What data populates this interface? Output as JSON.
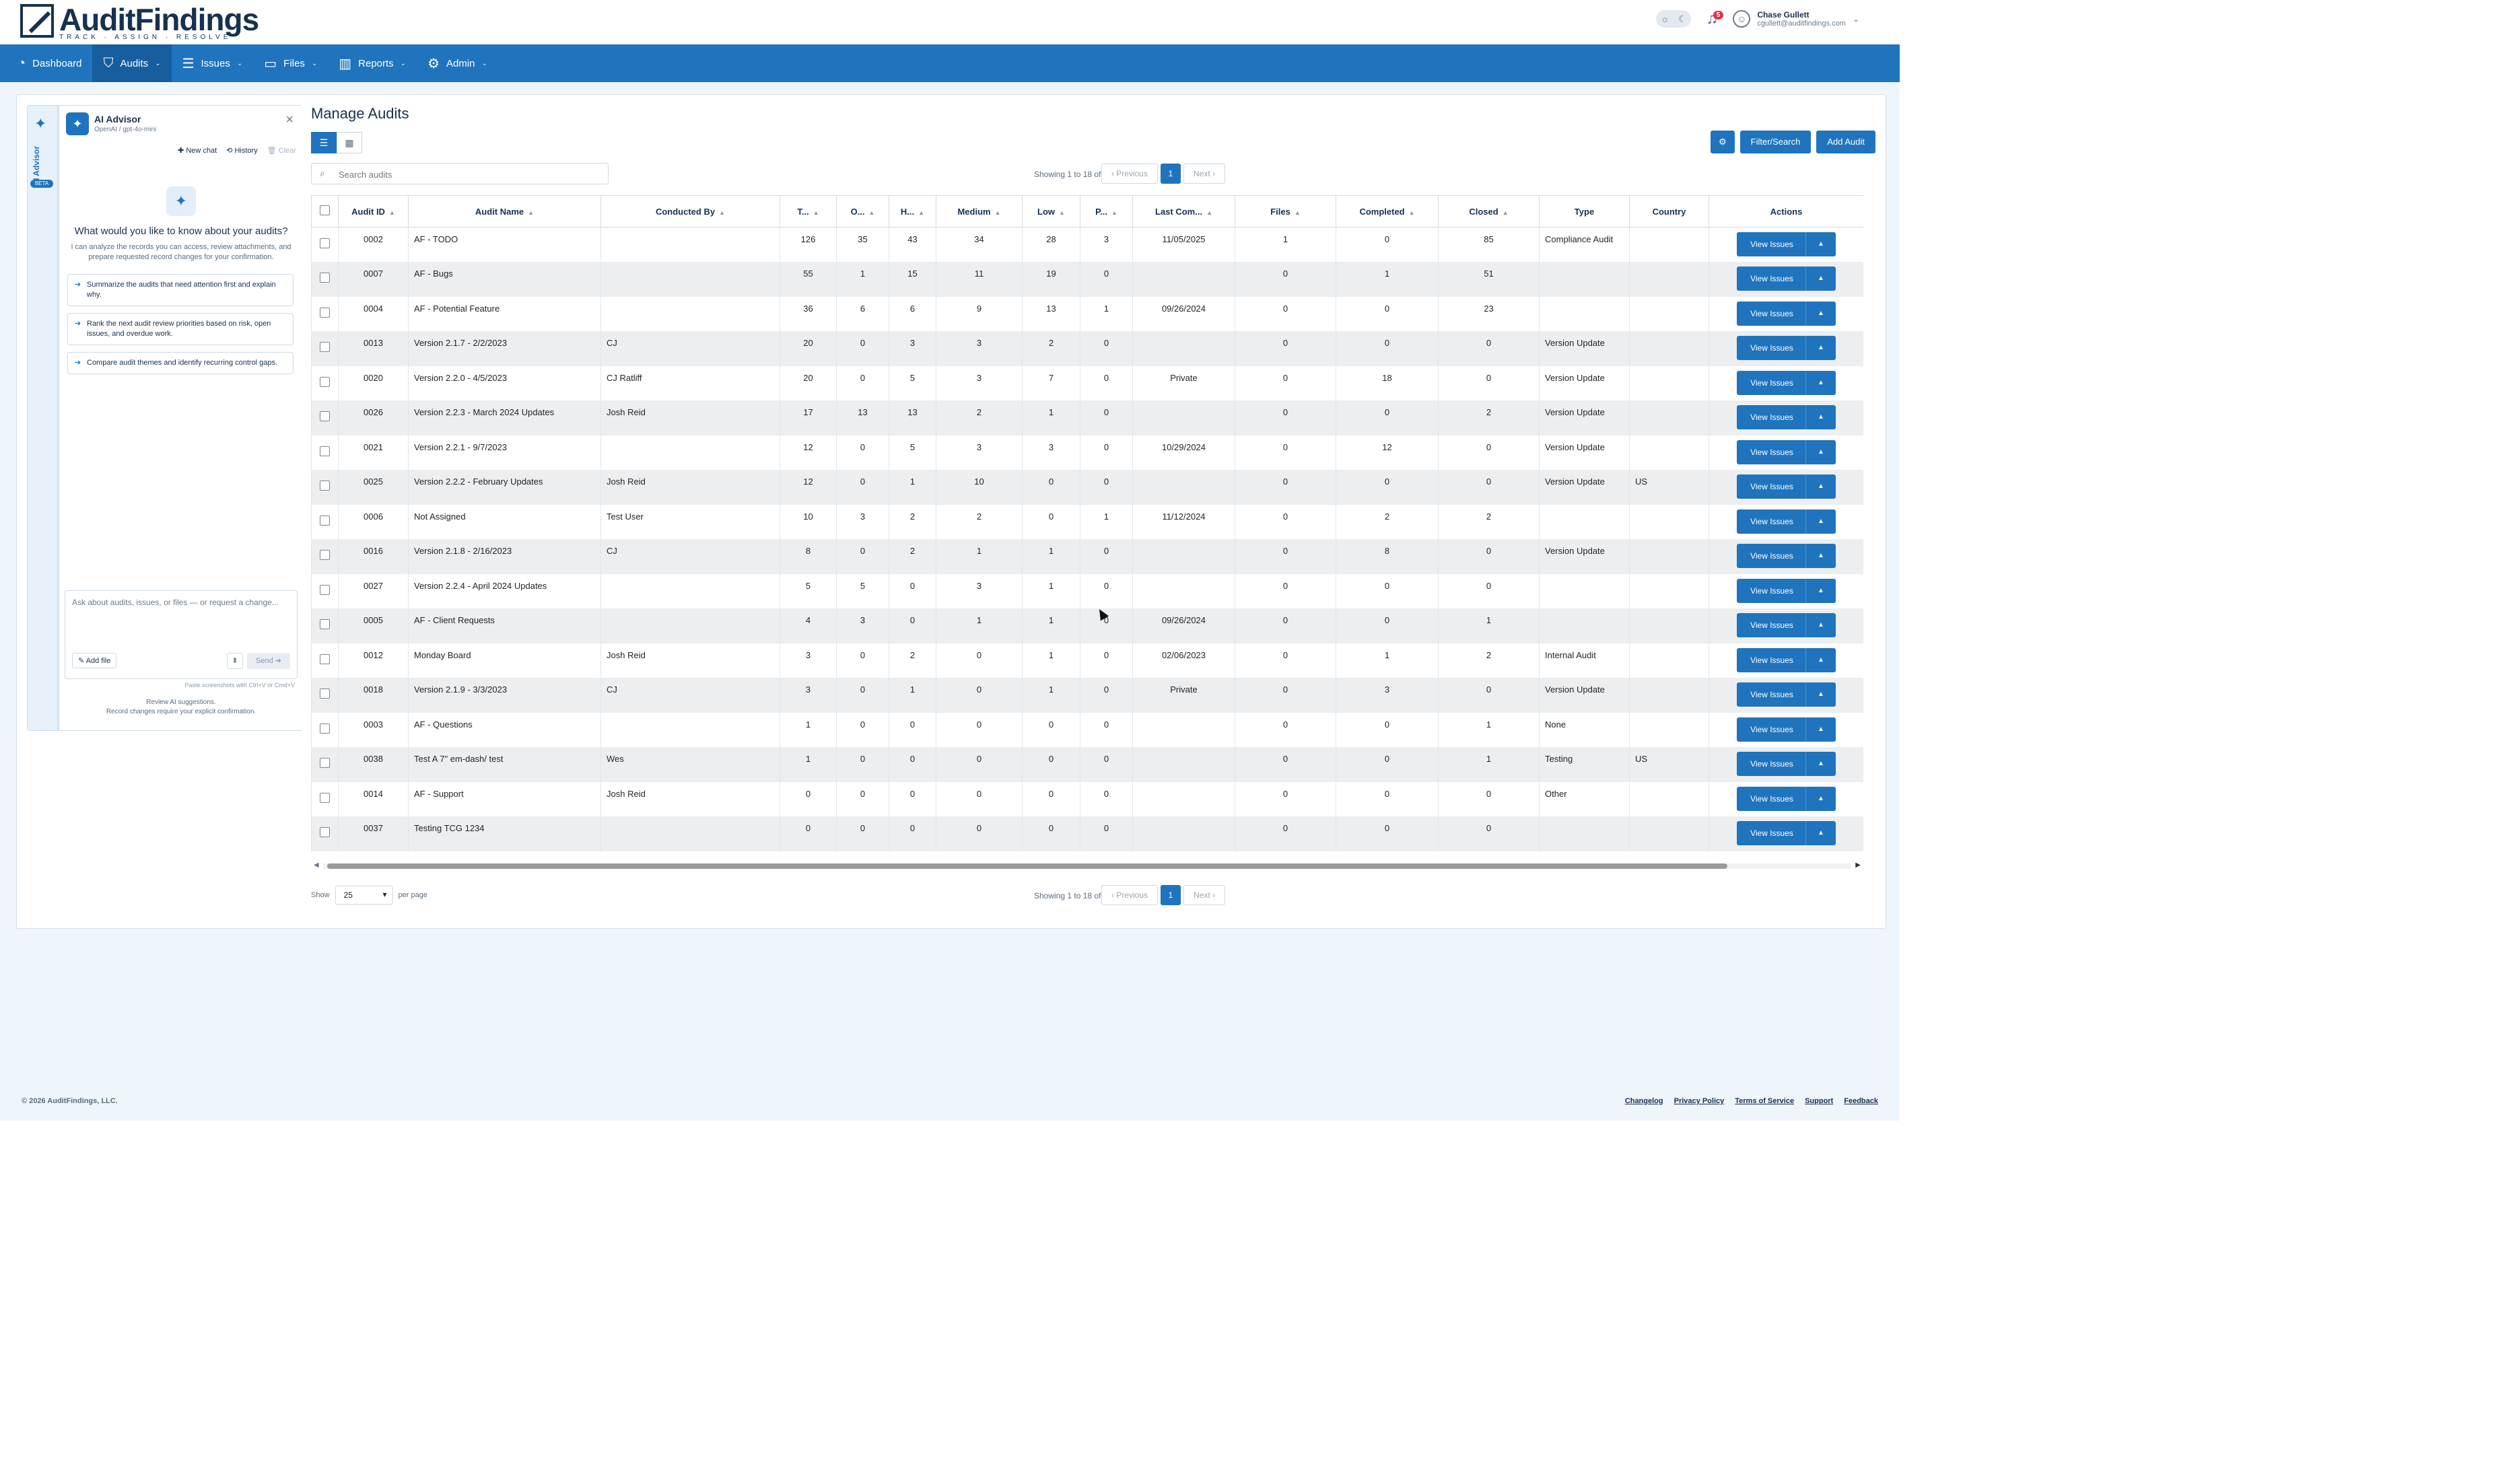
{
  "app": {
    "logo_name": "AuditFindings",
    "logo_tagline": "TRACK · ASSIGN · RESOLVE",
    "user_name": "Chase Gullett",
    "user_email": "cgullett@auditfindings.com",
    "notification_count": "5"
  },
  "nav": [
    {
      "label": "Dashboard",
      "icon": "dashboard-icon",
      "active": false,
      "caret": false
    },
    {
      "label": "Audits",
      "icon": "shield-icon",
      "active": true,
      "caret": true
    },
    {
      "label": "Issues",
      "icon": "list-icon",
      "active": false,
      "caret": true
    },
    {
      "label": "Files",
      "icon": "folder-icon",
      "active": false,
      "caret": true
    },
    {
      "label": "Reports",
      "icon": "chart-icon",
      "active": false,
      "caret": true
    },
    {
      "label": "Admin",
      "icon": "users-gear-icon",
      "active": false,
      "caret": true
    }
  ],
  "ai": {
    "strip_label": "AI Advisor",
    "strip_badge": "BETA",
    "title": "AI Advisor",
    "model": "OpenAI / gpt-4o-mini",
    "new_chat": "✚ New chat",
    "history": "⟲ History",
    "clear": "🗑 Clear",
    "question": "What would you like to know about your audits?",
    "description": "I can analyze the records you can access, review attachments, and prepare requested record changes for your confirmation.",
    "suggestions": [
      "Summarize the audits that need attention first and explain why.",
      "Rank the next audit review priorities based on risk, open issues, and overdue work.",
      "Compare audit themes and identify recurring control gaps."
    ],
    "input_placeholder": "Ask about audits, issues, or files — or request a change...",
    "add_file": "✎ Add file",
    "send": "Send ➔",
    "paste_hint": "Paste screenshots with Ctrl+V or Cmd+V",
    "footer_line1": "Review AI suggestions.",
    "footer_line2": "Record changes require your explicit confirmation."
  },
  "page": {
    "title": "Manage Audits",
    "filter_button": "Filter/Search",
    "add_button": "Add Audit",
    "search_placeholder": "Search audits",
    "showing": "Showing 1 to 18 of 18 entries",
    "prev": "‹ Previous",
    "next": "Next ›",
    "page_num": "1",
    "show_label": "Show",
    "per_page_value": "25",
    "per_page_label": "per page"
  },
  "table": {
    "columns": [
      "Audit ID",
      "Audit Name",
      "Conducted By",
      "T...",
      "O...",
      "H...",
      "Medium",
      "Low",
      "P...",
      "Last Com...",
      "Files",
      "Completed",
      "Closed",
      "Type",
      "Country",
      "Actions"
    ],
    "action_label": "View Issues",
    "rows": [
      [
        "0002",
        "AF - TODO",
        "",
        "126",
        "35",
        "43",
        "34",
        "28",
        "3",
        "11/05/2025",
        "1",
        "0",
        "85",
        "Compliance Audit",
        ""
      ],
      [
        "0007",
        "AF - Bugs",
        "",
        "55",
        "1",
        "15",
        "11",
        "19",
        "0",
        "",
        "0",
        "1",
        "51",
        "",
        ""
      ],
      [
        "0004",
        "AF - Potential Feature",
        "",
        "36",
        "6",
        "6",
        "9",
        "13",
        "1",
        "09/26/2024",
        "0",
        "0",
        "23",
        "",
        ""
      ],
      [
        "0013",
        "Version 2.1.7 - 2/2/2023",
        "CJ",
        "20",
        "0",
        "3",
        "3",
        "2",
        "0",
        "",
        "0",
        "0",
        "0",
        "Version Update",
        ""
      ],
      [
        "0020",
        "Version 2.2.0 - 4/5/2023",
        "CJ Ratliff",
        "20",
        "0",
        "5",
        "3",
        "7",
        "0",
        "Private",
        "0",
        "18",
        "0",
        "Version Update",
        ""
      ],
      [
        "0026",
        "Version 2.2.3 - March 2024 Updates",
        "Josh Reid",
        "17",
        "13",
        "13",
        "2",
        "1",
        "0",
        "",
        "0",
        "0",
        "2",
        "Version Update",
        ""
      ],
      [
        "0021",
        "Version 2.2.1 - 9/7/2023",
        "",
        "12",
        "0",
        "5",
        "3",
        "3",
        "0",
        "10/29/2024",
        "0",
        "12",
        "0",
        "Version Update",
        ""
      ],
      [
        "0025",
        "Version 2.2.2 - February Updates",
        "Josh Reid",
        "12",
        "0",
        "1",
        "10",
        "0",
        "0",
        "",
        "0",
        "0",
        "0",
        "Version Update",
        "US"
      ],
      [
        "0006",
        "Not Assigned",
        "Test User",
        "10",
        "3",
        "2",
        "2",
        "0",
        "1",
        "11/12/2024",
        "0",
        "2",
        "2",
        "",
        ""
      ],
      [
        "0016",
        "Version 2.1.8 - 2/16/2023",
        "CJ",
        "8",
        "0",
        "2",
        "1",
        "1",
        "0",
        "",
        "0",
        "8",
        "0",
        "Version Update",
        ""
      ],
      [
        "0027",
        "Version 2.2.4 - April 2024 Updates",
        "",
        "5",
        "5",
        "0",
        "3",
        "1",
        "0",
        "",
        "0",
        "0",
        "0",
        "",
        ""
      ],
      [
        "0005",
        "AF - Client Requests",
        "",
        "4",
        "3",
        "0",
        "1",
        "1",
        "0",
        "09/26/2024",
        "0",
        "0",
        "1",
        "",
        ""
      ],
      [
        "0012",
        "Monday Board",
        "Josh Reid",
        "3",
        "0",
        "2",
        "0",
        "1",
        "0",
        "02/06/2023",
        "0",
        "1",
        "2",
        "Internal Audit",
        ""
      ],
      [
        "0018",
        "Version 2.1.9 - 3/3/2023",
        "CJ",
        "3",
        "0",
        "1",
        "0",
        "1",
        "0",
        "Private",
        "0",
        "3",
        "0",
        "Version Update",
        ""
      ],
      [
        "0003",
        "AF - Questions",
        "",
        "1",
        "0",
        "0",
        "0",
        "0",
        "0",
        "",
        "0",
        "0",
        "1",
        "None",
        ""
      ],
      [
        "0038",
        "Test A 7\" em-dash/ test",
        "Wes",
        "1",
        "0",
        "0",
        "0",
        "0",
        "0",
        "",
        "0",
        "0",
        "1",
        "Testing",
        "US"
      ],
      [
        "0014",
        "AF - Support",
        "Josh Reid",
        "0",
        "0",
        "0",
        "0",
        "0",
        "0",
        "",
        "0",
        "0",
        "0",
        "Other",
        ""
      ],
      [
        "0037",
        "Testing TCG 1234",
        "",
        "0",
        "0",
        "0",
        "0",
        "0",
        "0",
        "",
        "0",
        "0",
        "0",
        "",
        ""
      ]
    ]
  },
  "footer": {
    "copyright": "© 2026 AuditFindings, LLC.",
    "links": [
      "Changelog",
      "Privacy Policy",
      "Terms of Service",
      "Support",
      "Feedback"
    ]
  }
}
